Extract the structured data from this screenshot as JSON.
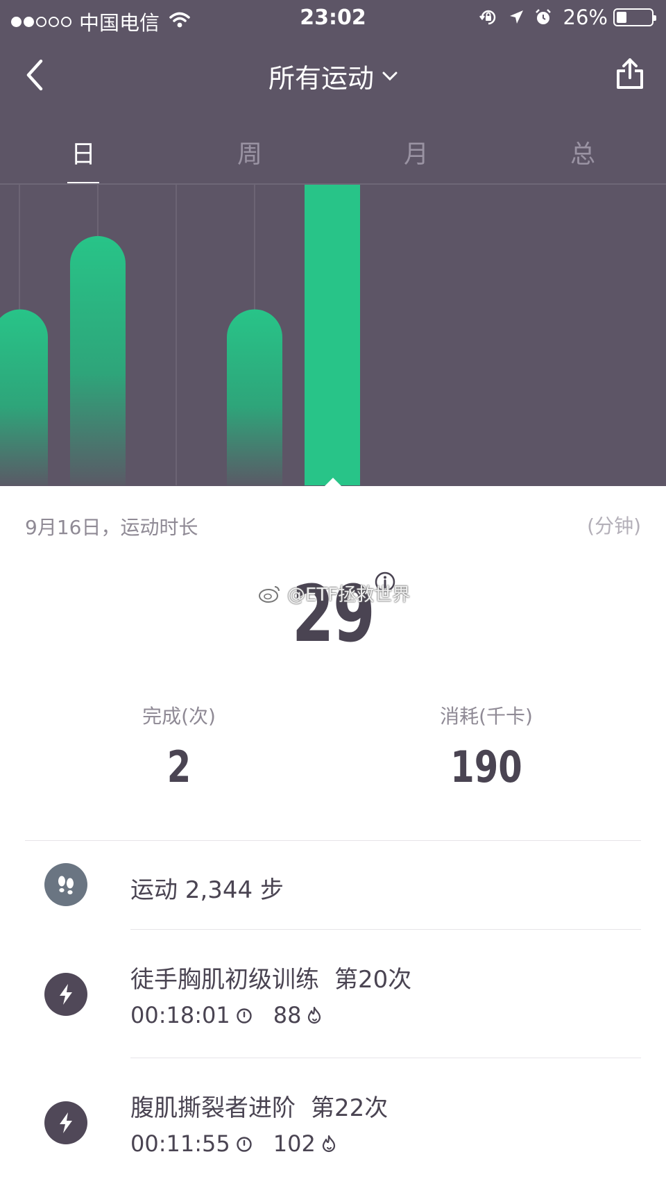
{
  "status_bar": {
    "carrier": "中国电信",
    "time": "23:02",
    "battery": "26%"
  },
  "header": {
    "title": "所有运动"
  },
  "tabs": [
    {
      "label": "日",
      "active": true
    },
    {
      "label": "周",
      "active": false
    },
    {
      "label": "月",
      "active": false
    },
    {
      "label": "总",
      "active": false
    }
  ],
  "chart_data": {
    "type": "bar",
    "categories": [
      "",
      "",
      "",
      "",
      "9月16日"
    ],
    "values": [
      24,
      34,
      null,
      24,
      41
    ],
    "selected_index": 4,
    "ylim": [
      0,
      41
    ],
    "colors": {
      "bar": "#28c488",
      "background": "#5d5566"
    }
  },
  "summary": {
    "date_label": "9月16日，运动时长",
    "unit": "(分钟)",
    "duration_value": "29",
    "watermark": "@ETF拯救世界",
    "completed_label": "完成(次)",
    "completed_value": "2",
    "calories_label": "消耗(千卡)",
    "calories_value": "190"
  },
  "activities": [
    {
      "type": "steps",
      "icon": "footprints-icon",
      "title": "运动 2,344 步"
    },
    {
      "type": "workout",
      "icon": "lightning-icon",
      "title": "徒手胸肌初级训练",
      "count": "第20次",
      "duration": "00:18:01",
      "calories": "88"
    },
    {
      "type": "workout",
      "icon": "lightning-icon",
      "title": "腹肌撕裂者进阶",
      "count": "第22次",
      "duration": "00:11:55",
      "calories": "102"
    }
  ]
}
